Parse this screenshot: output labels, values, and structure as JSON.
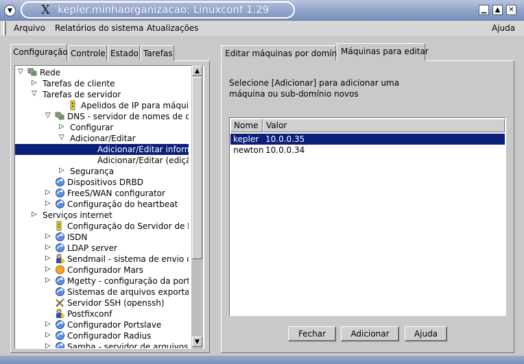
{
  "window": {
    "title": "kepler.minhaorganizacao: Linuxconf 1.29",
    "x_icon": "X",
    "window_menu_icon": "▼",
    "minimize_icon": "▁",
    "maximize_icon": "▲",
    "close_icon": "✕"
  },
  "menubar": {
    "items": [
      "Arquivo",
      "Relatórios do sistema",
      "Atualizações"
    ],
    "help": "Ajuda"
  },
  "left_tabs": [
    "Configuração",
    "Controle",
    "Estado",
    "Tarefas"
  ],
  "tree": [
    {
      "label": "Rede",
      "toggle": "open",
      "icon": "network-icon"
    },
    {
      "label": "Tarefas de cliente",
      "toggle": "closed",
      "icon": ""
    },
    {
      "label": "Tarefas de servidor",
      "toggle": "open",
      "icon": ""
    },
    {
      "label": "Apelidos de IP para máquinas v",
      "toggle": "",
      "icon": "config-icon"
    },
    {
      "label": "DNS - servidor de nomes de do",
      "toggle": "open",
      "icon": "network-icon"
    },
    {
      "label": "Configurar",
      "toggle": "closed",
      "icon": ""
    },
    {
      "label": "Adicionar/Editar",
      "toggle": "open",
      "icon": ""
    },
    {
      "label": "Adicionar/Editar informaçõ",
      "toggle": "",
      "icon": "",
      "selected": true
    },
    {
      "label": "Adicionar/Editar (edição ráp",
      "toggle": "",
      "icon": ""
    },
    {
      "label": "Segurança",
      "toggle": "closed",
      "icon": ""
    },
    {
      "label": "Dispositivos DRBD",
      "toggle": "",
      "icon": "globe-icon"
    },
    {
      "label": "FreeS/WAN configurator",
      "toggle": "closed",
      "icon": "globe-icon"
    },
    {
      "label": "Configuração do heartbeat",
      "toggle": "closed",
      "icon": "globe-icon"
    },
    {
      "label": "Serviços internet",
      "toggle": "closed",
      "icon": ""
    },
    {
      "label": "Configuração do Servidor de IP",
      "toggle": "",
      "icon": "config-icon"
    },
    {
      "label": "ISDN",
      "toggle": "closed",
      "icon": "globe-icon"
    },
    {
      "label": "LDAP server",
      "toggle": "closed",
      "icon": "globe-icon"
    },
    {
      "label": "Sendmail - sistema de envio de",
      "toggle": "closed",
      "icon": "person-icon"
    },
    {
      "label": "Configurador Mars",
      "toggle": "closed",
      "icon": "sun-icon"
    },
    {
      "label": "Mgetty - configuração da porta",
      "toggle": "closed",
      "icon": "globe-icon"
    },
    {
      "label": "Sistemas de arquivos exportado",
      "toggle": "",
      "icon": "globe-icon"
    },
    {
      "label": "Servidor SSH (openssh)",
      "toggle": "",
      "icon": "tools-icon"
    },
    {
      "label": "Postfixconf",
      "toggle": "",
      "icon": "person-icon"
    },
    {
      "label": "Configurador Portslave",
      "toggle": "closed",
      "icon": "globe-icon"
    },
    {
      "label": "Configurador Radius",
      "toggle": "closed",
      "icon": "globe-icon"
    },
    {
      "label": "Samba - servidor de arquivos",
      "toggle": "closed",
      "icon": "globe-icon"
    }
  ],
  "right_tabs": [
    "Editar máquinas por domínio",
    "Máquinas para editar"
  ],
  "instructions": [
    "Selecione [Adicionar] para adicionar uma",
    "máquina ou sub-domínio novos"
  ],
  "list": {
    "headers": [
      "Nome",
      "Valor"
    ],
    "rows": [
      {
        "name": "kepler",
        "value": "10.0.0.35",
        "selected": true
      },
      {
        "name": "newton",
        "value": "10.0.0.34",
        "selected": false
      }
    ]
  },
  "buttons": {
    "close": "Fechar",
    "add": "Adicionar",
    "help": "Ajuda"
  },
  "colors": {
    "selection": "#0b1f7a",
    "titlebar": "#8fa2c8"
  }
}
